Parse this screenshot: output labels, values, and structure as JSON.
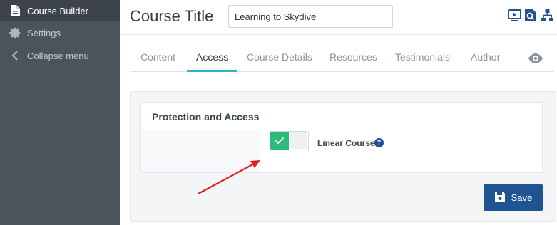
{
  "sidebar": {
    "items": [
      {
        "label": "Course Builder",
        "icon": "document-icon",
        "active": true
      },
      {
        "label": "Settings",
        "icon": "gear-icon",
        "active": false
      },
      {
        "label": "Collapse menu",
        "icon": "chevron-left-icon",
        "active": false
      }
    ]
  },
  "header": {
    "title": "Course Title",
    "title_input_value": "Learning to Skydive",
    "icons": [
      "preview-icon",
      "search-icon",
      "sitemap-icon"
    ]
  },
  "tabs": [
    {
      "label": "Content",
      "active": false
    },
    {
      "label": "Access",
      "active": true
    },
    {
      "label": "Course Details",
      "active": false
    },
    {
      "label": "Resources",
      "active": false
    },
    {
      "label": "Testimonials",
      "active": false
    },
    {
      "label": "Author",
      "active": false
    }
  ],
  "section": {
    "title": "Protection and Access",
    "linear_course": {
      "label": "Linear Course",
      "enabled": true,
      "help": "?"
    }
  },
  "actions": {
    "save_label": "Save"
  },
  "colors": {
    "sidebar": "#4b545d",
    "accent": "#2bb3c8",
    "toggle_on": "#2dbb7a",
    "primary": "#1f5391",
    "annotation_arrow": "#e02020"
  }
}
